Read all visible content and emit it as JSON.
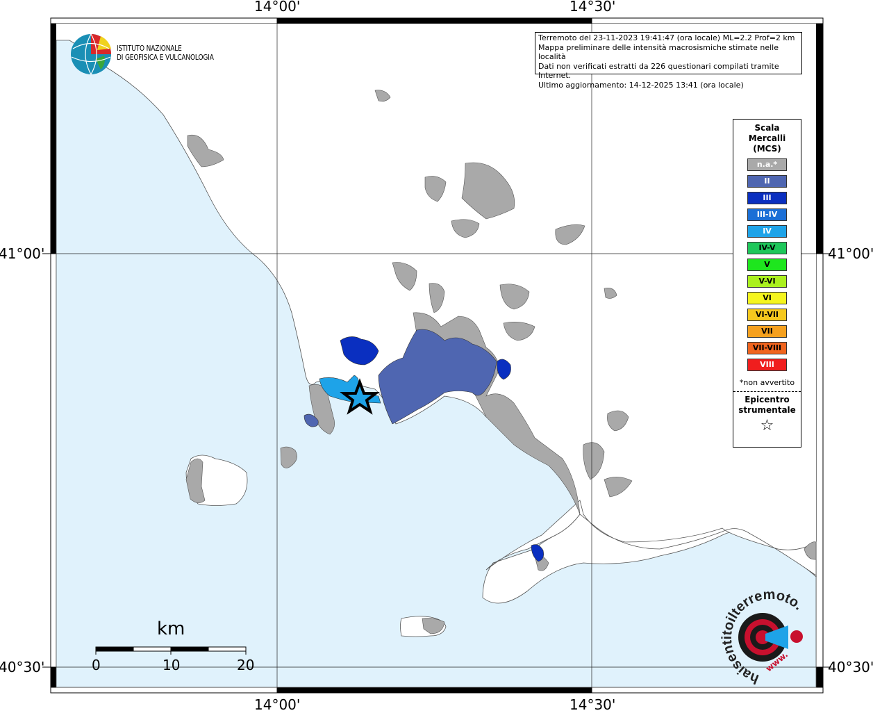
{
  "axis_labels": {
    "top_left": "14°00'",
    "top_right": "14°30'",
    "bottom_left": "14°00'",
    "bottom_right": "14°30'",
    "left_upper": "41°00'",
    "left_lower": "40°30'",
    "right_upper": "41°00'",
    "right_lower": "40°30'"
  },
  "logo_ingv": {
    "line1": "ISTITUTO NAZIONALE",
    "line2": "DI GEOFISICA E VULCANOLOGIA"
  },
  "info": {
    "line1": "Terremoto del 23-11-2023 19:41:47 (ora locale) ML=2.2 Prof=2 km",
    "line2": "Mappa preliminare delle intensità macrosismiche stimate nelle località",
    "line3": "Dati non verificati estratti da 226 questionari compilati tramite Internet.",
    "line4": "Ultimo aggiornamento: 14-12-2025 13:41 (ora locale)"
  },
  "legend": {
    "title": "Scala\nMercalli\n(MCS)",
    "items": [
      {
        "label": "n.a.*",
        "color": "#a9a9a9",
        "text_color": "#ffffff"
      },
      {
        "label": "II",
        "color": "#4f66b1",
        "text_color": "#ffffff"
      },
      {
        "label": "III",
        "color": "#0a2fc0",
        "text_color": "#ffffff"
      },
      {
        "label": "III-IV",
        "color": "#1b6fd6",
        "text_color": "#ffffff"
      },
      {
        "label": "IV",
        "color": "#1ea3e8",
        "text_color": "#ffffff"
      },
      {
        "label": "IV-V",
        "color": "#1ec75a",
        "text_color": "#000000"
      },
      {
        "label": "V",
        "color": "#1ee61e",
        "text_color": "#000000"
      },
      {
        "label": "V-VI",
        "color": "#aaf01e",
        "text_color": "#000000"
      },
      {
        "label": "VI",
        "color": "#f5f51e",
        "text_color": "#000000"
      },
      {
        "label": "VI-VII",
        "color": "#f5c81e",
        "text_color": "#000000"
      },
      {
        "label": "VII",
        "color": "#f5a01e",
        "text_color": "#000000"
      },
      {
        "label": "VII-VIII",
        "color": "#f0641e",
        "text_color": "#000000"
      },
      {
        "label": "VIII",
        "color": "#f01e1e",
        "text_color": "#ffffff"
      }
    ],
    "note": "*non avvertito",
    "epicenter_label": "Epicentro\nstrumentale",
    "epicenter_symbol": "☆"
  },
  "scale_bar": {
    "unit": "km",
    "ticks": [
      "0",
      "10",
      "20"
    ]
  },
  "colors": {
    "sea": "#e0f2fc",
    "land": "#ffffff",
    "na_gray": "#a9a9a9"
  },
  "logo_hsit": {
    "text": "haisentitoilterremoto.it",
    "url_text": "www."
  }
}
